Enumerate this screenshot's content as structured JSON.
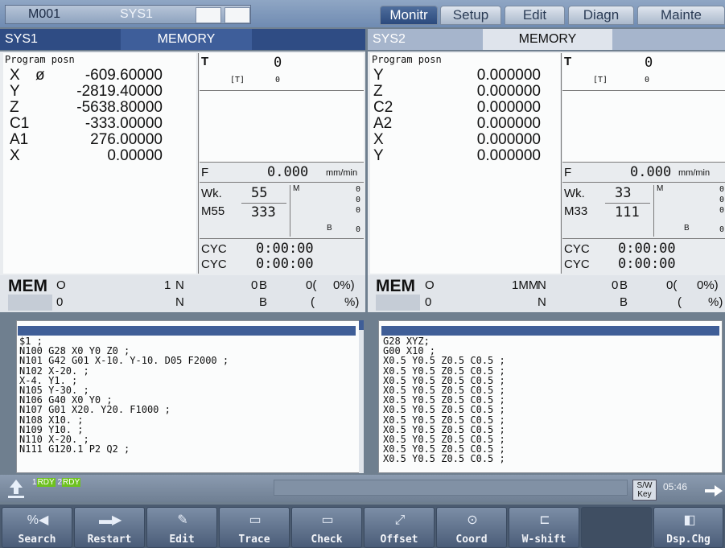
{
  "top": {
    "tab_left1": "M001",
    "tab_left2": "SYS1",
    "tabs": [
      "Monitr",
      "Setup",
      "Edit",
      "Diagn",
      "Mainte"
    ]
  },
  "sys1": {
    "name": "SYS1",
    "mode": "MEMORY",
    "posn_title": "Program posn",
    "axes": [
      {
        "name": "X",
        "mark": "ø",
        "value": "-609.60000"
      },
      {
        "name": "Y",
        "mark": "",
        "value": "-2819.40000"
      },
      {
        "name": "Z",
        "mark": "",
        "value": "-5638.80000"
      },
      {
        "name": "C1",
        "mark": "",
        "value": "-333.00000"
      },
      {
        "name": "A1",
        "mark": "",
        "value": "276.00000"
      },
      {
        "name": "X",
        "mark": "",
        "value": "0.00000"
      }
    ],
    "t_label": "T",
    "t_value": "0",
    "t_sub_label": "[T]",
    "t_sub_value": "0",
    "f_label": "F",
    "f_value": "0.000",
    "f_unit": "mm/min",
    "wk_label": "Wk.",
    "wk_value": "55",
    "m_label": "M55",
    "m_value": "333",
    "m_letter": "M",
    "b_letter": "B",
    "mcodes": [
      "0",
      "0",
      "0",
      "0"
    ],
    "cyc1_label": "CYC",
    "cyc1_value": "0:00:00",
    "cyc2_label": "CYC",
    "cyc2_value": "0:00:00",
    "mem_label": "MEM",
    "row1": {
      "o": "O",
      "o_num": "1",
      "n": "N",
      "n_num": "0",
      "b": "B",
      "b_num": "0(",
      "pct": "0%)"
    },
    "row2": {
      "o": "0",
      "n": "N",
      "b": "B",
      "paren": "(",
      "pct": "%)"
    },
    "program": [
      "$1 ;",
      "N100 G28 X0 Y0 Z0 ;",
      "N101 G42 G01 X-10. Y-10. D05 F2000 ;",
      "N102 X-20. ;",
      "X-4. Y1. ;",
      "N105 Y-30. ;",
      "N106 G40 X0 Y0 ;",
      "N107 G01 X20. Y20. F1000 ;",
      "N108 X10. ;",
      "N109 Y10. ;",
      "N110 X-20. ;",
      "N111 G120.1 P2 Q2 ;"
    ]
  },
  "sys2": {
    "name": "SYS2",
    "mode": "MEMORY",
    "posn_title": "Program posn",
    "axes": [
      {
        "name": "Y",
        "value": "0.000000"
      },
      {
        "name": "Z",
        "value": "0.000000"
      },
      {
        "name": "C2",
        "value": "0.000000"
      },
      {
        "name": "A2",
        "value": "0.000000"
      },
      {
        "name": "X",
        "value": "0.000000"
      },
      {
        "name": "Y",
        "value": "0.000000"
      }
    ],
    "t_label": "T",
    "t_value": "0",
    "t_sub_label": "[T]",
    "t_sub_value": "0",
    "f_label": "F",
    "f_value": "0.000",
    "f_unit": "mm/min",
    "wk_label": "Wk.",
    "wk_value": "33",
    "m_label": "M33",
    "m_value": "111",
    "m_letter": "M",
    "b_letter": "B",
    "mcodes": [
      "0",
      "0",
      "0",
      "0"
    ],
    "cyc1_label": "CYC",
    "cyc1_value": "0:00:00",
    "cyc2_label": "CYC",
    "cyc2_value": "0:00:00",
    "mem_label": "MEM",
    "row1": {
      "o": "O",
      "o_num": "1MM",
      "n": "N",
      "n_num": "0",
      "b": "B",
      "b_num": "0(",
      "pct": "0%)"
    },
    "row2": {
      "o": "0",
      "n": "N",
      "b": "B",
      "paren": "(",
      "pct": "%)"
    },
    "program": [
      "G28 XYZ;",
      "G00 X10 ;",
      "X0.5 Y0.5 Z0.5 C0.5 ;",
      "X0.5 Y0.5 Z0.5 C0.5 ;",
      "X0.5 Y0.5 Z0.5 C0.5 ;",
      "X0.5 Y0.5 Z0.5 C0.5 ;",
      "X0.5 Y0.5 Z0.5 C0.5 ;",
      "X0.5 Y0.5 Z0.5 C0.5 ;",
      "X0.5 Y0.5 Z0.5 C0.5 ;",
      "X0.5 Y0.5 Z0.5 C0.5 ;",
      "X0.5 Y0.5 Z0.5 C0.5 ;",
      "X0.5 Y0.5 Z0.5 C0.5 ;",
      "X0.5 Y0.5 Z0.5 C0.5 ;"
    ]
  },
  "status": {
    "rdy1_num": "1",
    "rdy1": "RDY",
    "rdy2_num": "2",
    "rdy2": "RDY",
    "sw_key": "S/W Key",
    "clock": "05:46"
  },
  "menu": [
    "Search",
    "Restart",
    "Edit",
    "Trace",
    "Check",
    "Offset",
    "Coord",
    "W-shift",
    "",
    "Dsp.Chg"
  ],
  "icons": [
    "back-arrow-icon",
    "next-arrow-icon"
  ]
}
